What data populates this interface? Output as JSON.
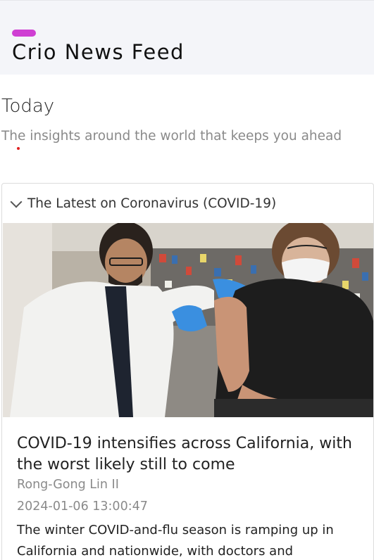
{
  "header": {
    "app_title": "Crio News Feed",
    "accent_color": "#cf3fd3"
  },
  "intro": {
    "title": "Today",
    "subtitle": "The insights around the world that keeps you ahead"
  },
  "sections": [
    {
      "label": "The Latest on Coronavirus (COVID-19)",
      "expanded": true,
      "icon": "chevron-down-icon",
      "articles": [
        {
          "image_alt": "news-photo",
          "headline": "COVID-19 intensifies across California, with the worst likely still to come",
          "author": "Rong-Gong Lin II",
          "published": "2024-01-06 13:00:47",
          "summary": "The winter COVID-and-flu season is ramping up in California and nationwide, with doctors and"
        }
      ]
    }
  ]
}
